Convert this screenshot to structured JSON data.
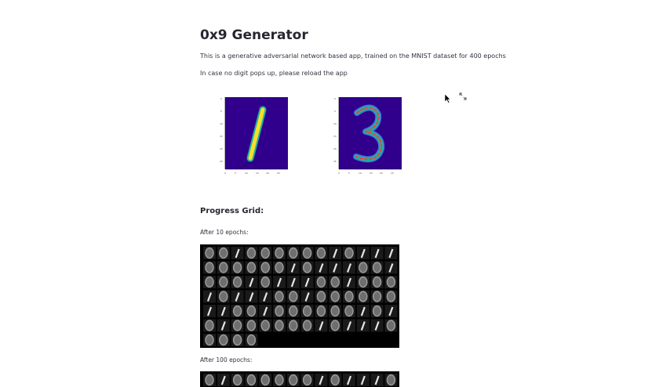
{
  "page": {
    "title": "0x9 Generator",
    "description": "This is a generative adversarial network based app, trained on the MNIST dataset for 400 epochs",
    "reload_note": "In case no digit pops up, please reload the app"
  },
  "plots": [
    {
      "digit": "1"
    },
    {
      "digit": "3"
    }
  ],
  "progress": {
    "heading": "Progress Grid:",
    "grids": [
      {
        "label": "After 10 epochs:"
      },
      {
        "label": "After 100 epochs:"
      }
    ],
    "sample_digits_row": [
      "0",
      "0",
      "1",
      "0",
      "0",
      "0",
      "0",
      "0",
      "0",
      "1",
      "0",
      "1",
      "1",
      "1"
    ]
  },
  "colors": {
    "plot_bg": "#30008c",
    "digit_hot": "#f7e02a",
    "digit_mid": "#21b1a5",
    "digit_edge": "#3e73d9"
  },
  "icons": [
    "fullscreen-expand-icon",
    "mouse-cursor-icon"
  ]
}
